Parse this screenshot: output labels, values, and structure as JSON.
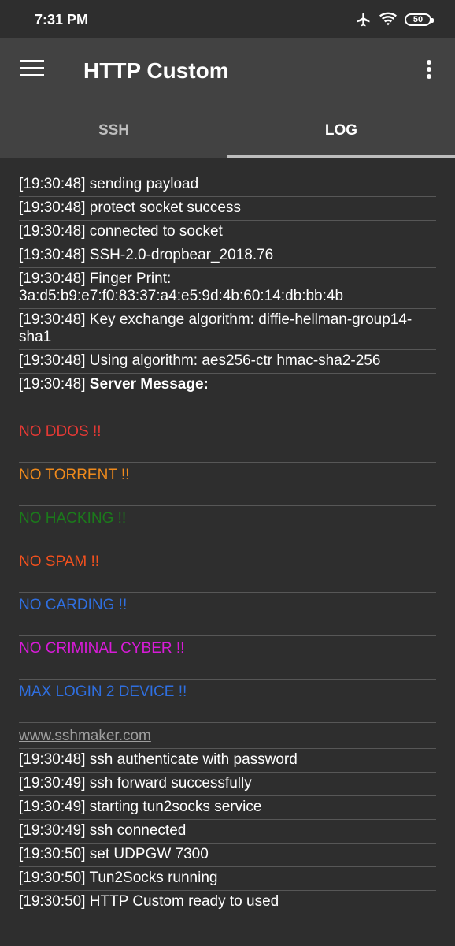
{
  "status_bar": {
    "time": "7:31 PM",
    "battery": "50"
  },
  "app_bar": {
    "title": "HTTP Custom"
  },
  "tabs": [
    {
      "label": "SSH"
    },
    {
      "label": "LOG"
    }
  ],
  "log_top": [
    "[19:30:48] sending payload",
    "[19:30:48] protect socket success",
    "[19:30:48] connected to socket",
    "[19:30:48] SSH-2.0-dropbear_2018.76",
    "[19:30:48] Finger Print: 3a:d5:b9:e7:f0:83:37:a4:e5:9d:4b:60:14:db:bb:4b",
    "[19:30:48] Key exchange algorithm: diffie-hellman-group14-sha1",
    "[19:30:48] Using algorithm: aes256-ctr hmac-sha2-256"
  ],
  "server_message": {
    "prefix": "[19:30:48] ",
    "label": "Server Message:"
  },
  "messages": [
    {
      "text": "NO DDOS !!",
      "color": "#e53935"
    },
    {
      "text": "NO TORRENT !!",
      "color": "#ef8a1c"
    },
    {
      "text": "NO HACKING !!",
      "color": "#1b7a1b"
    },
    {
      "text": "NO SPAM !!",
      "color": "#f4511e"
    },
    {
      "text": "NO CARDING !!",
      "color": "#2f6fe0"
    },
    {
      "text": "NO CRIMINAL CYBER !!",
      "color": "#d81bd8"
    },
    {
      "text": "MAX LOGIN 2 DEVICE !!",
      "color": "#2f6fe0"
    }
  ],
  "link": "www.sshmaker.com",
  "log_bottom": [
    "[19:30:48] ssh authenticate with password",
    "[19:30:49] ssh forward successfully",
    "[19:30:49] starting tun2socks service",
    "[19:30:49] ssh connected",
    "[19:30:50] set UDPGW 7300",
    "[19:30:50] Tun2Socks running",
    "[19:30:50] HTTP Custom ready to used"
  ]
}
